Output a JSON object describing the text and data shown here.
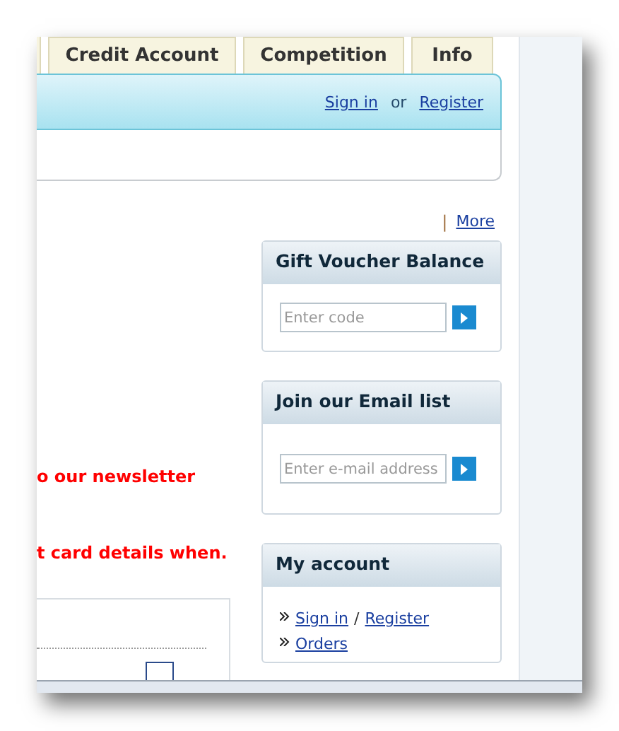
{
  "tabs": [
    {
      "label": "Credit Account",
      "selected": false
    },
    {
      "label": "Competition",
      "selected": false
    },
    {
      "label": "Info",
      "selected": false
    }
  ],
  "auth_bar": {
    "sign_in": "Sign in",
    "separator": "or",
    "register": "Register"
  },
  "more_link": {
    "separator": "|",
    "label": "More"
  },
  "notices": [
    "o our newsletter",
    "t card details when."
  ],
  "sidebar": [
    {
      "kind": "form",
      "title": "Gift Voucher Balance",
      "placeholder": "Enter code"
    },
    {
      "kind": "form",
      "title": "Join our Email list",
      "placeholder": "Enter e-mail address"
    },
    {
      "kind": "links",
      "title": "My account",
      "links": [
        {
          "parts": [
            "Sign in",
            "Register"
          ],
          "separator": "/"
        },
        {
          "parts": [
            "Orders"
          ]
        }
      ]
    }
  ]
}
